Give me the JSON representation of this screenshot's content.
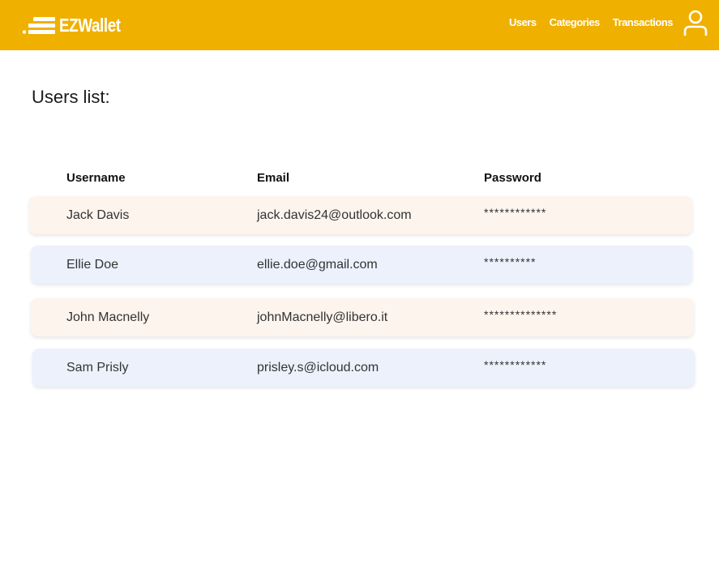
{
  "navbar": {
    "brand": "EZWallet",
    "links": [
      "Users",
      "Categories",
      "Transactions"
    ],
    "user_icon": "user-icon",
    "logo_icon": "speed-lines-logo",
    "background": "#efb000"
  },
  "page": {
    "title": "Users list:"
  },
  "table": {
    "columns": [
      "Username",
      "Email",
      "Password"
    ],
    "rows": [
      {
        "username": "Jack Davis",
        "email": "jack.davis24@outlook.com",
        "password": "************"
      },
      {
        "username": "Ellie Doe",
        "email": "ellie.doe@gmail.com",
        "password": "**********"
      },
      {
        "username": "John Macnelly",
        "email": "johnMacnelly@libero.it",
        "password": "**************"
      },
      {
        "username": "Sam Prisly",
        "email": "prisley.s@icloud.com",
        "password": "************"
      }
    ],
    "row_colors": [
      "#fdf4ee",
      "#ecf1fc"
    ]
  }
}
